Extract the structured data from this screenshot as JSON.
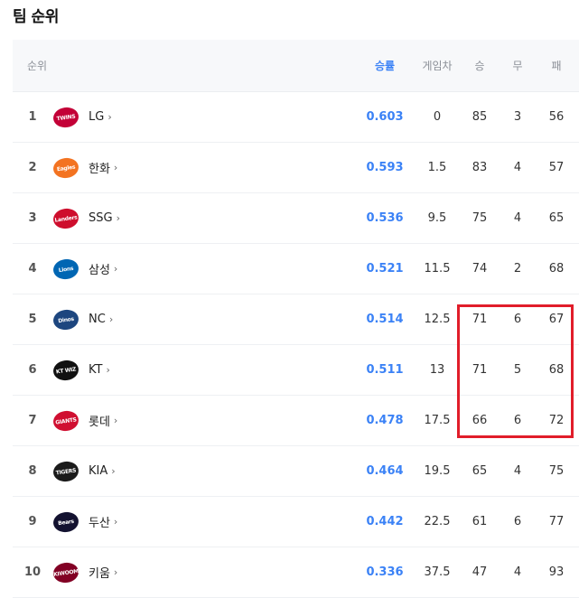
{
  "title": "팀 순위",
  "header": {
    "rank": "순위",
    "pct": "승률",
    "gb": "게임차",
    "w": "승",
    "d": "무",
    "l": "패"
  },
  "rows": [
    {
      "rank": "1",
      "team": "LG",
      "logo": "TWINS",
      "color": "#c30037",
      "pct": "0.603",
      "gb": "0",
      "w": "85",
      "d": "3",
      "l": "56"
    },
    {
      "rank": "2",
      "team": "한화",
      "logo": "Eagles",
      "color": "#f37321",
      "pct": "0.593",
      "gb": "1.5",
      "w": "83",
      "d": "4",
      "l": "57"
    },
    {
      "rank": "3",
      "team": "SSG",
      "logo": "Landers",
      "color": "#ce0e2d",
      "pct": "0.536",
      "gb": "9.5",
      "w": "75",
      "d": "4",
      "l": "65"
    },
    {
      "rank": "4",
      "team": "삼성",
      "logo": "Lions",
      "color": "#0066b3",
      "pct": "0.521",
      "gb": "11.5",
      "w": "74",
      "d": "2",
      "l": "68"
    },
    {
      "rank": "5",
      "team": "NC",
      "logo": "Dinos",
      "color": "#1d467f",
      "pct": "0.514",
      "gb": "12.5",
      "w": "71",
      "d": "6",
      "l": "67"
    },
    {
      "rank": "6",
      "team": "KT",
      "logo": "KT WIZ",
      "color": "#111111",
      "pct": "0.511",
      "gb": "13",
      "w": "71",
      "d": "5",
      "l": "68"
    },
    {
      "rank": "7",
      "team": "롯데",
      "logo": "GIANTS",
      "color": "#d00f31",
      "pct": "0.478",
      "gb": "17.5",
      "w": "66",
      "d": "6",
      "l": "72"
    },
    {
      "rank": "8",
      "team": "KIA",
      "logo": "TIGERS",
      "color": "#1b1b1b",
      "pct": "0.464",
      "gb": "19.5",
      "w": "65",
      "d": "4",
      "l": "75"
    },
    {
      "rank": "9",
      "team": "두산",
      "logo": "Bears",
      "color": "#131230",
      "pct": "0.442",
      "gb": "22.5",
      "w": "61",
      "d": "6",
      "l": "77"
    },
    {
      "rank": "10",
      "team": "키움",
      "logo": "KIWOOM",
      "color": "#820024",
      "pct": "0.336",
      "gb": "37.5",
      "w": "47",
      "d": "4",
      "l": "93"
    }
  ],
  "highlight_color": "#e11d2a"
}
